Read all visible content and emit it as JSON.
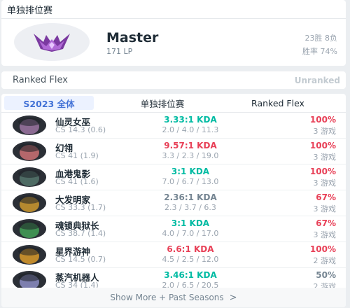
{
  "solo": {
    "title": "单独排位赛",
    "tier": "Master",
    "lp": "171 LP",
    "win_loss": "23胜 8负",
    "win_rate": "胜率 74%"
  },
  "flex": {
    "title": "Ranked Flex",
    "status": "Unranked"
  },
  "tabs": [
    "S2023 全体",
    "单独排位赛",
    "Ranked Flex"
  ],
  "champions": [
    {
      "name": "仙灵女巫",
      "cs": "CS 14.3 (0.6)",
      "kda": "3.33:1 KDA",
      "kda_line": "2.0 / 4.0 / 11.3",
      "win_rate": "100%",
      "games": "3 游戏",
      "kda_color": "#00bba3",
      "wr_color": "#e84057",
      "avatar_color": "#8b6a92"
    },
    {
      "name": "幻翎",
      "cs": "CS 41 (1.9)",
      "kda": "9.57:1 KDA",
      "kda_line": "3.3 / 2.3 / 19.0",
      "win_rate": "100%",
      "games": "3 游戏",
      "kda_color": "#e84057",
      "wr_color": "#e84057",
      "avatar_color": "#b5676b"
    },
    {
      "name": "血港鬼影",
      "cs": "CS 41 (1.6)",
      "kda": "3:1 KDA",
      "kda_line": "7.0 / 6.7 / 13.0",
      "win_rate": "100%",
      "games": "3 游戏",
      "kda_color": "#00bba3",
      "wr_color": "#e84057",
      "avatar_color": "#4e6b64"
    },
    {
      "name": "大发明家",
      "cs": "CS 33.3 (1.7)",
      "kda": "2.36:1 KDA",
      "kda_line": "2.3 / 3.7 / 6.3",
      "win_rate": "67%",
      "games": "3 游戏",
      "kda_color": "#758592",
      "wr_color": "#e84057",
      "avatar_color": "#b5892f"
    },
    {
      "name": "魂锁典狱长",
      "cs": "CS 38.7 (1.4)",
      "kda": "3:1 KDA",
      "kda_line": "4.0 / 7.0 / 17.0",
      "win_rate": "67%",
      "games": "3 游戏",
      "kda_color": "#00bba3",
      "wr_color": "#e84057",
      "avatar_color": "#3f8f52"
    },
    {
      "name": "星界游神",
      "cs": "CS 14.5 (0.7)",
      "kda": "6.6:1 KDA",
      "kda_line": "4.5 / 2.5 / 12.0",
      "win_rate": "100%",
      "games": "2 游戏",
      "kda_color": "#e84057",
      "wr_color": "#e84057",
      "avatar_color": "#c08a2c"
    },
    {
      "name": "蒸汽机器人",
      "cs": "CS 34 (1.4)",
      "kda": "3.46:1 KDA",
      "kda_line": "2.0 / 6.5 / 20.5",
      "win_rate": "50%",
      "games": "2 游戏",
      "kda_color": "#00bba3",
      "wr_color": "#758592",
      "avatar_color": "#7d7fae"
    }
  ],
  "show_more": "Show More + Past Seasons"
}
